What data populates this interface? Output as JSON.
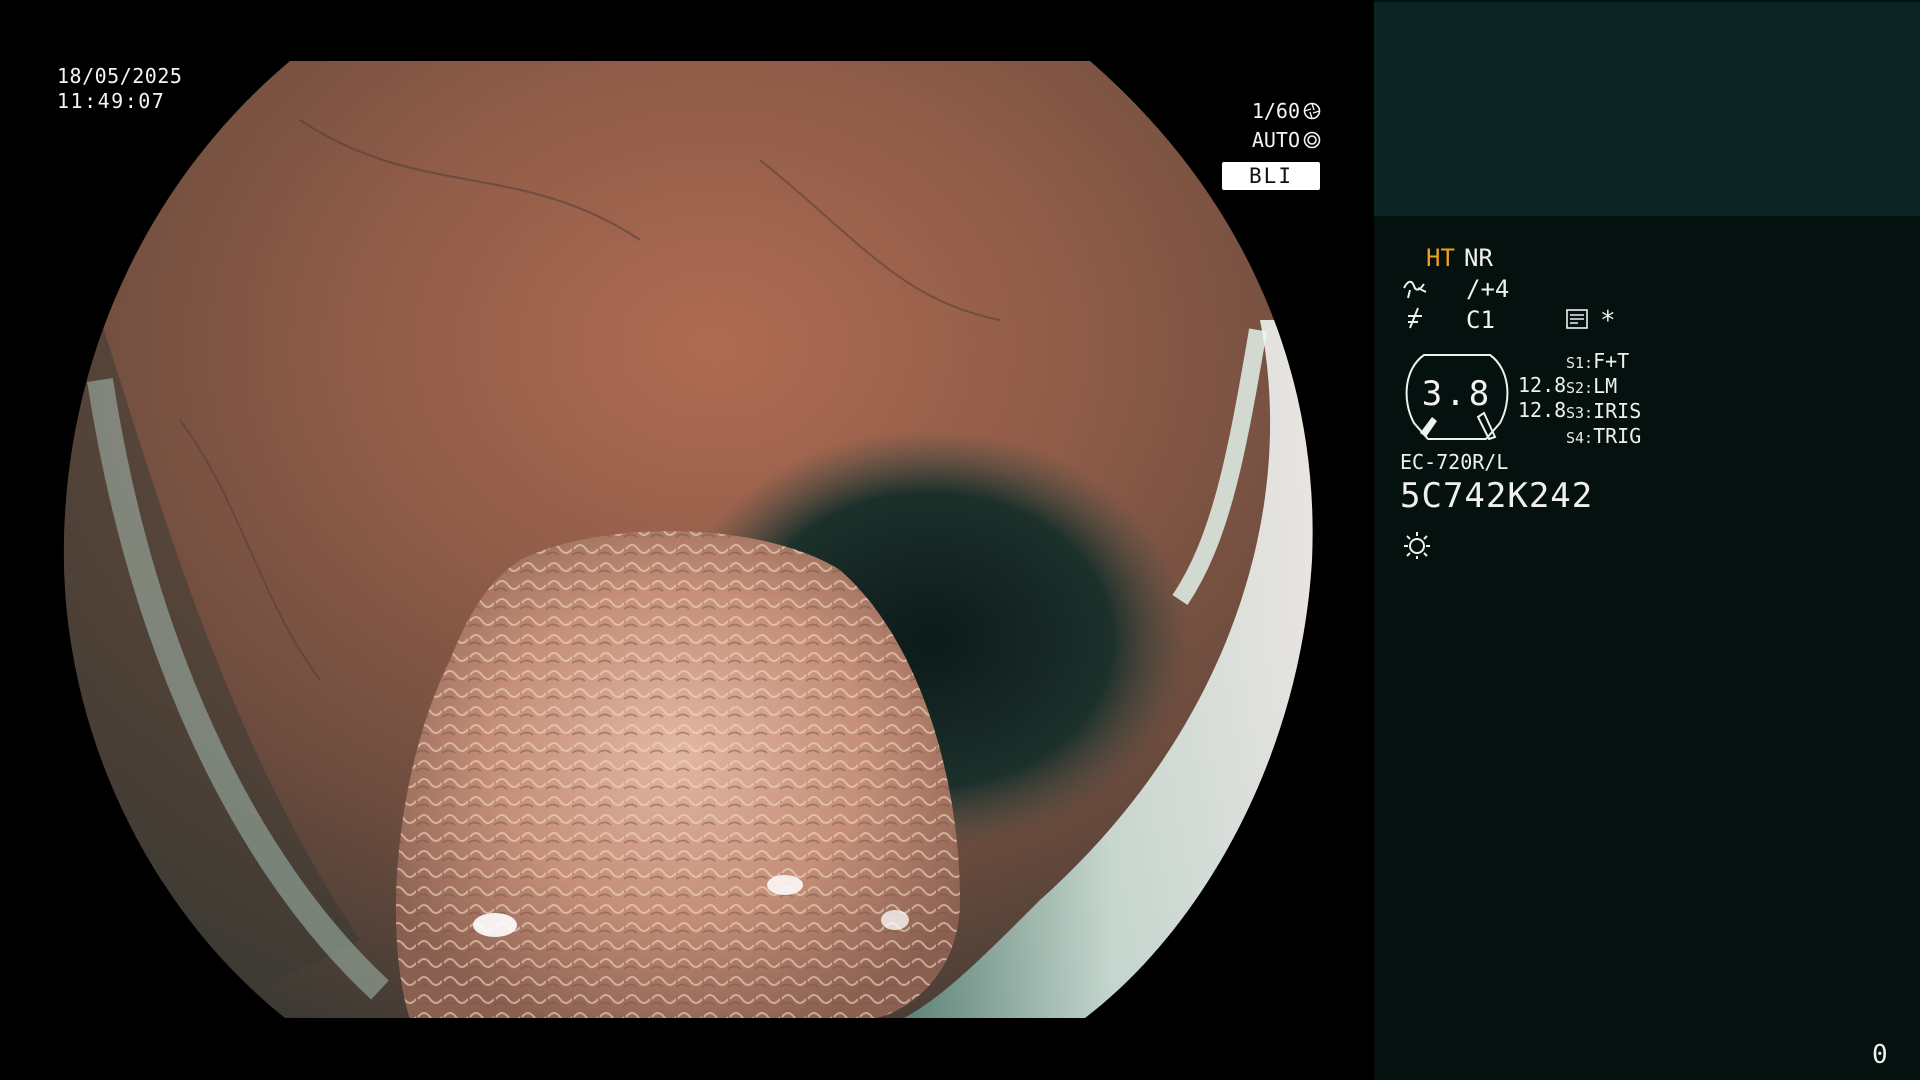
{
  "overlay": {
    "date": "18/05/2025",
    "time": "11:49:07",
    "shutter": "1/60",
    "exposure": "AUTO",
    "mode": "BLI"
  },
  "panel": {
    "ht_label": "HT",
    "nr_label": "NR",
    "enhance_value": "/+4",
    "color_value": "C1",
    "memo_mark": "*",
    "zoom_value": "3.8",
    "zoom_range_1": "12.8",
    "zoom_range_2": "12.8",
    "switches": [
      {
        "key": "S1:",
        "value": "F+T"
      },
      {
        "key": "S2:",
        "value": "LM"
      },
      {
        "key": "S3:",
        "value": "IRIS"
      },
      {
        "key": "S4:",
        "value": "TRIG"
      }
    ],
    "scope_model": "EC-720R/L",
    "scope_serial": "5C742K242",
    "frame_counter": "0"
  },
  "colors": {
    "panel_bg": "#04110f",
    "panel_header_bg": "#0c2424",
    "ht_accent": "#f0a020",
    "text": "#f0f0f0"
  },
  "icons": {
    "shutter": "aperture-icon",
    "exposure": "iris-icon",
    "enhance": "structure-enhance-icon",
    "color": "color-mode-icon",
    "memo": "memo-icon",
    "light": "light-source-icon"
  }
}
